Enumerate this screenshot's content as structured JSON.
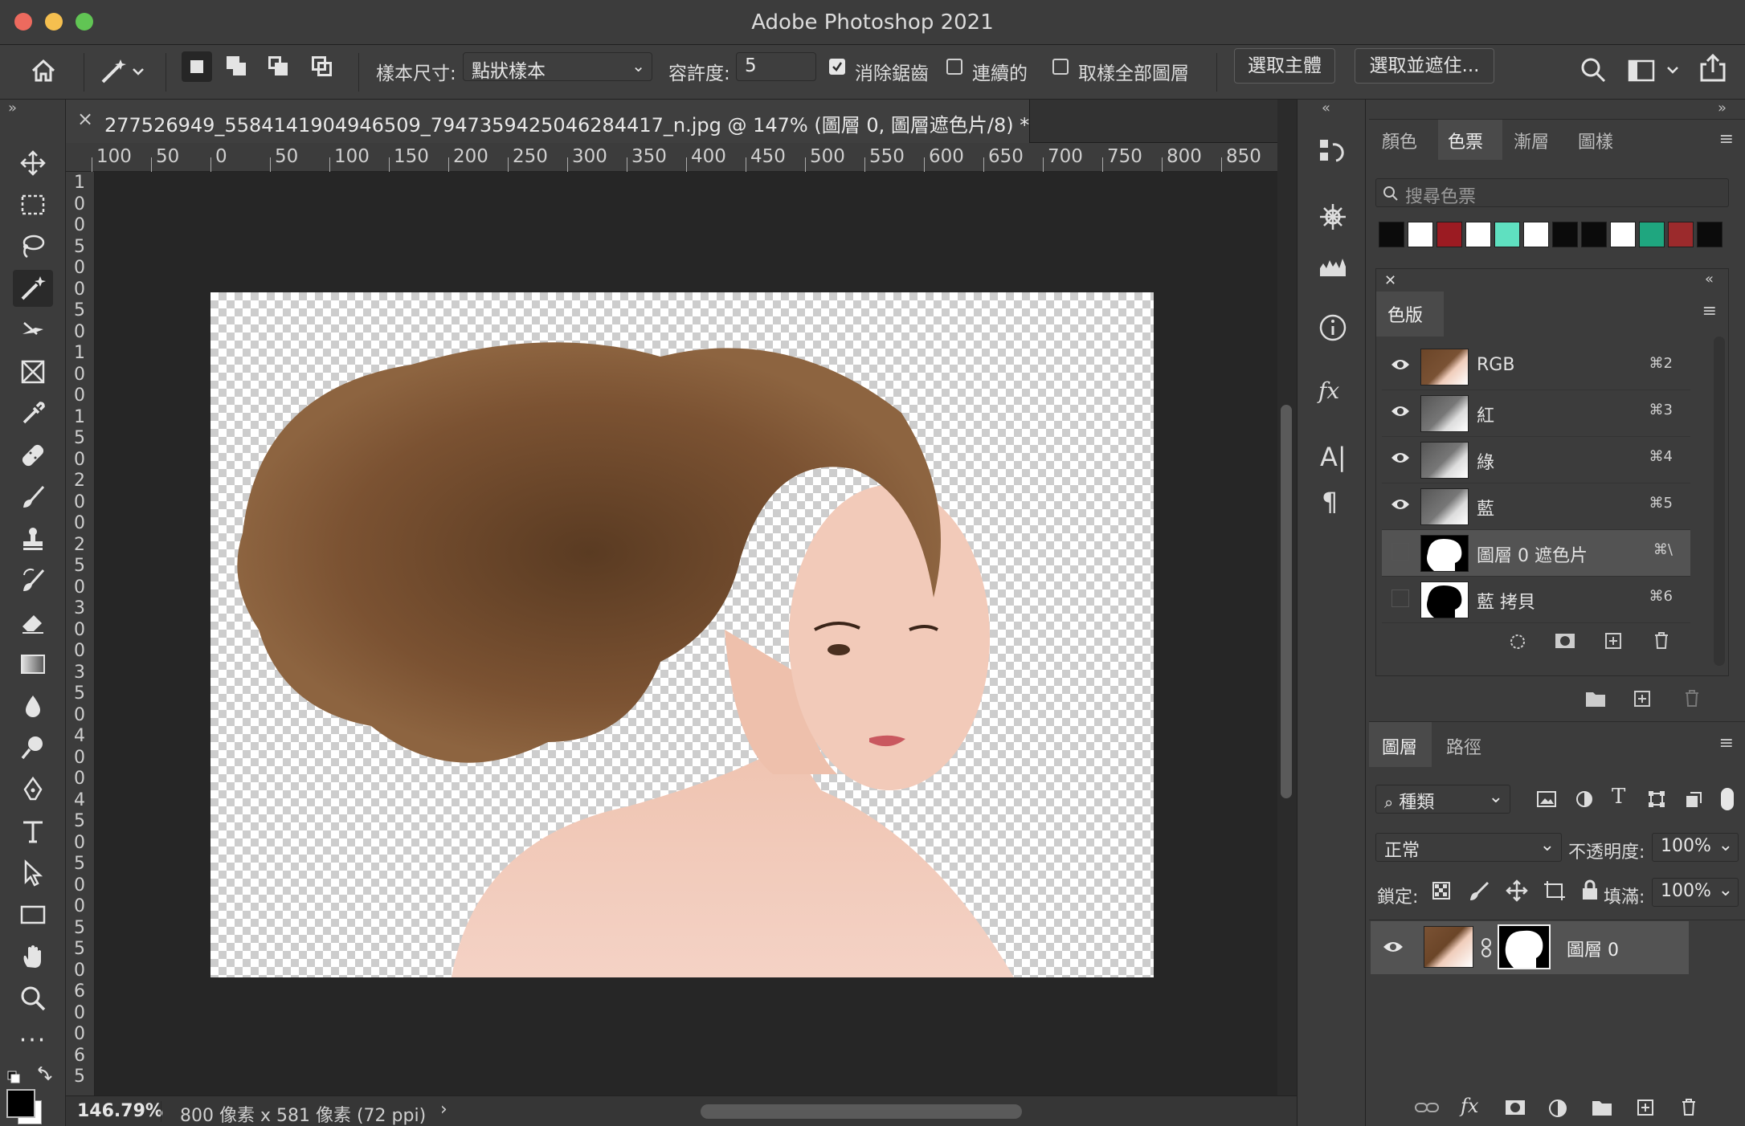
{
  "window": {
    "title": "Adobe Photoshop 2021"
  },
  "options_bar": {
    "sample_size_label": "樣本尺寸:",
    "sample_size_value": "點狀樣本",
    "tolerance_label": "容許度:",
    "tolerance_value": "5",
    "antialias": {
      "label": "消除鋸齒",
      "checked": true
    },
    "contiguous": {
      "label": "連續的",
      "checked": false
    },
    "sample_all": {
      "label": "取樣全部圖層",
      "checked": false
    },
    "select_subject": "選取主體",
    "select_mask": "選取並遮住..."
  },
  "document": {
    "tab_title": "277526949_5584141904946509_7947359425046284417_n.jpg @ 147% (圖層 0, 圖層遮色片/8) *",
    "ruler_h": [
      "100",
      "50",
      "0",
      "50",
      "100",
      "150",
      "200",
      "250",
      "300",
      "350",
      "400",
      "450",
      "500",
      "550",
      "600",
      "650",
      "700",
      "750",
      "800",
      "850"
    ],
    "ruler_v": [
      "1",
      "0",
      "0",
      "5",
      "0",
      "0",
      "5",
      "0",
      "1",
      "0",
      "0",
      "1",
      "5",
      "0",
      "2",
      "0",
      "0",
      "2",
      "5",
      "0",
      "3",
      "0",
      "0",
      "3",
      "5",
      "0",
      "4",
      "0",
      "0",
      "4",
      "5",
      "0",
      "5",
      "0",
      "0",
      "5",
      "5",
      "0",
      "6",
      "0",
      "0",
      "6",
      "5"
    ],
    "zoom": "146.79%",
    "size_info": "800 像素 x 581 像素 (72 ppi)"
  },
  "swatches_panel": {
    "tabs": [
      "顏色",
      "色票",
      "漸層",
      "圖樣"
    ],
    "active_tab": "色票",
    "search_placeholder": "搜尋色票",
    "colors": [
      "#0b0b0b",
      "#ffffff",
      "#9b1b22",
      "#ffffff",
      "#5fe0c0",
      "#ffffff",
      "#0b0b0b",
      "#0b0b0b",
      "#ffffff",
      "#1fa67f",
      "#9b2a2c",
      "#0b0b0b"
    ]
  },
  "channels_panel": {
    "title": "色版",
    "rows": [
      {
        "name": "RGB",
        "key": "⌘2",
        "visible": true,
        "thumb": "photo"
      },
      {
        "name": "紅",
        "key": "⌘3",
        "visible": true,
        "thumb": "gray"
      },
      {
        "name": "綠",
        "key": "⌘4",
        "visible": true,
        "thumb": "gray"
      },
      {
        "name": "藍",
        "key": "⌘5",
        "visible": true,
        "thumb": "gray"
      },
      {
        "name": "圖層 0 遮色片",
        "key": "⌘\\",
        "visible": false,
        "thumb": "mask-white"
      },
      {
        "name": "藍 拷貝",
        "key": "⌘6",
        "visible": false,
        "thumb": "mask-black"
      }
    ]
  },
  "layers_panel": {
    "tabs": [
      "圖層",
      "路徑"
    ],
    "filter_label": "種類",
    "blend_mode": "正常",
    "opacity_label": "不透明度:",
    "opacity": "100%",
    "lock_label": "鎖定:",
    "fill_label": "填滿:",
    "fill": "100%",
    "layers": [
      {
        "name": "圖層 0",
        "visible": true
      }
    ]
  }
}
